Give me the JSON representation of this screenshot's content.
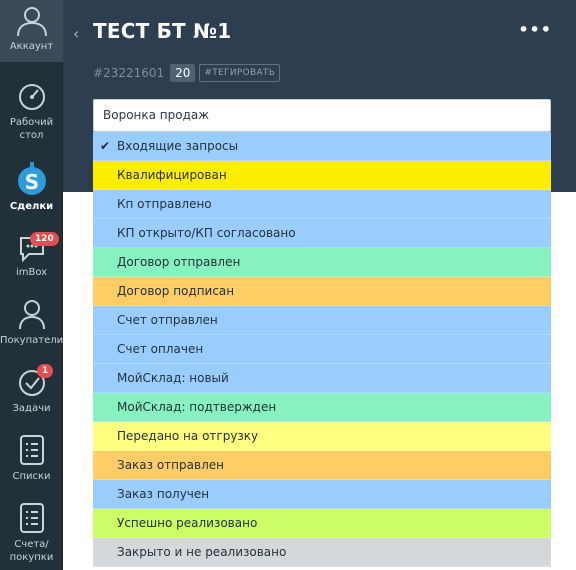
{
  "sidebar": {
    "items": [
      {
        "label": "Аккаунт",
        "icon": "account-icon"
      },
      {
        "label": "Рабочий\nстол",
        "icon": "dashboard-icon"
      },
      {
        "label": "Сделки",
        "icon": "deals-icon"
      },
      {
        "label": "imBox",
        "icon": "imbox-icon",
        "badge": "120"
      },
      {
        "label": "Покупатели",
        "icon": "customers-icon"
      },
      {
        "label": "Задачи",
        "icon": "tasks-icon",
        "badge": "1"
      },
      {
        "label": "Списки",
        "icon": "lists-icon"
      },
      {
        "label": "Счета/\nпокупки",
        "icon": "invoices-icon"
      }
    ]
  },
  "header": {
    "back_symbol": "‹",
    "title": "ТЕСТ БТ №1",
    "more_symbol": "•••",
    "deal_id": "#23221601",
    "deal_number": "20",
    "tag_button": "#ТЕГИРОВАТЬ"
  },
  "pipeline": {
    "selected": "Воронка продаж",
    "options": [
      {
        "label": "Входящие запросы",
        "color": "#99ccff",
        "checked": true
      },
      {
        "label": "Квалифицирован",
        "color": "#ffee00"
      },
      {
        "label": "Кп отправлено",
        "color": "#99ccff"
      },
      {
        "label": "КП открыто/КП согласовано",
        "color": "#99ccff"
      },
      {
        "label": "Договор отправлен",
        "color": "#87f2c0"
      },
      {
        "label": "Договор подписан",
        "color": "#ffcc66"
      },
      {
        "label": "Счет отправлен",
        "color": "#99ccff"
      },
      {
        "label": "Счет оплачен",
        "color": "#99ccff"
      },
      {
        "label": "МойСклад: новый",
        "color": "#99ccff"
      },
      {
        "label": "МойСклад: подтвержден",
        "color": "#87f2c0"
      },
      {
        "label": "Передано на отгрузку",
        "color": "#ffff80"
      },
      {
        "label": "Заказ отправлен",
        "color": "#ffcc66"
      },
      {
        "label": "Заказ получен",
        "color": "#99ccff"
      },
      {
        "label": "Успешно реализовано",
        "color": "#ccff66"
      },
      {
        "label": "Закрыто и не реализовано",
        "color": "#d5d8db"
      }
    ],
    "check_symbol": "✔"
  }
}
